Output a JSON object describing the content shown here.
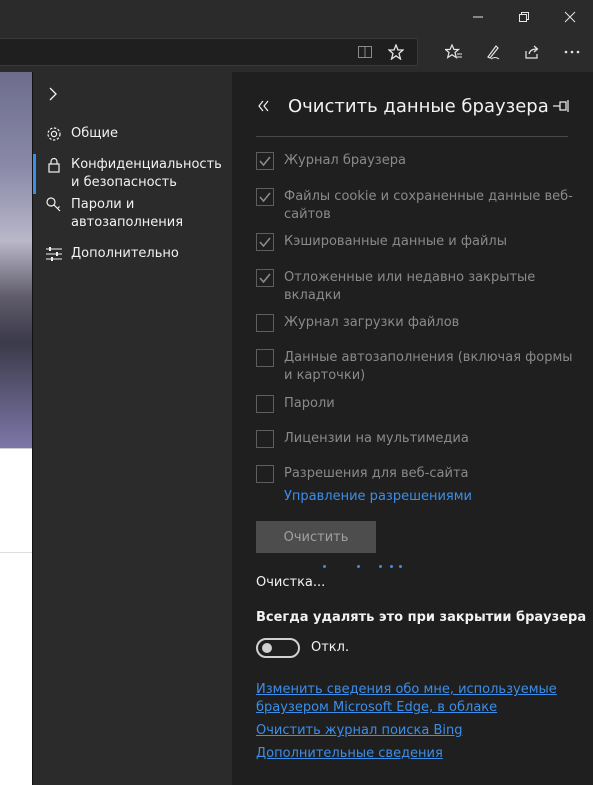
{
  "panel": {
    "title": "Очистить данные браузера",
    "items": [
      {
        "label": "Журнал браузера",
        "checked": true
      },
      {
        "label": "Файлы cookie и сохраненные данные веб-сайтов",
        "checked": true
      },
      {
        "label": "Кэшированные данные и файлы",
        "checked": true
      },
      {
        "label": "Отложенные или недавно закрытые вкладки",
        "checked": true
      },
      {
        "label": "Журнал загрузки файлов",
        "checked": false
      },
      {
        "label": "Данные автозаполнения (включая формы и карточки)",
        "checked": false
      },
      {
        "label": "Пароли",
        "checked": false
      },
      {
        "label": "Лицензии на мультимедиа",
        "checked": false
      },
      {
        "label": "Разрешения для веб-сайта",
        "checked": false
      }
    ],
    "manage_link": "Управление разрешениями",
    "clear_button": "Очистить",
    "status": "Очистка...",
    "always_clear_heading": "Всегда удалять это при закрытии браузера",
    "toggle_state": "Откл.",
    "links": [
      "Изменить сведения обо мне, используемые браузером Microsoft Edge, в облаке",
      "Очистить журнал поиска Bing",
      "Дополнительные сведения"
    ]
  },
  "nav": {
    "items": [
      {
        "label": "Общие",
        "icon": "gear-icon"
      },
      {
        "label": "Конфиденциальность и безопасность",
        "icon": "lock-icon",
        "selected": true
      },
      {
        "label": "Пароли и автозаполнения",
        "icon": "key-icon"
      },
      {
        "label": "Дополнительно",
        "icon": "sliders-icon"
      }
    ]
  },
  "colors": {
    "accent": "#3b8eea",
    "panel_bg": "#1f1f1f",
    "nav_bg": "#2b2b2b"
  }
}
